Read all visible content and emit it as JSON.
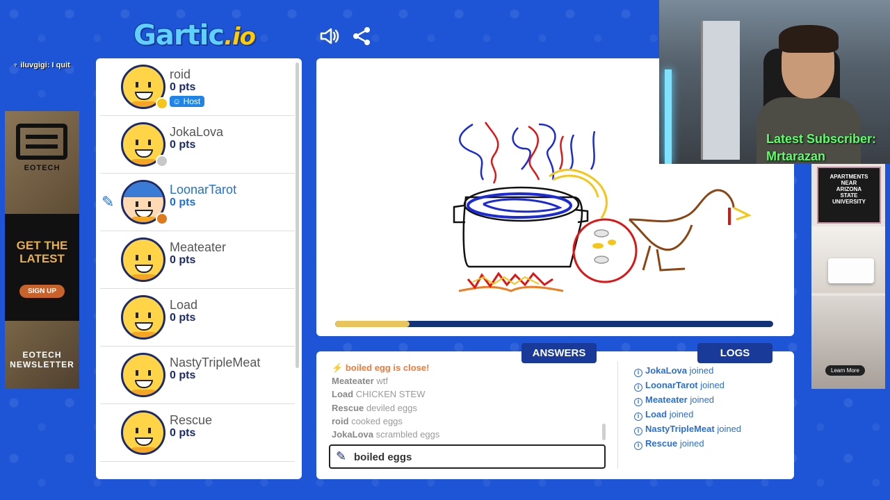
{
  "app": {
    "logo_main": "Gartic",
    "logo_suffix": ".io"
  },
  "toolbar": {
    "sound_icon": "speaker-icon",
    "share_icon": "share-icon"
  },
  "stream_chat": {
    "message": "iluvgigi: I quit"
  },
  "ad_left": {
    "brand": "EOTECH",
    "headline_line1": "GET THE",
    "headline_line2": "LATEST",
    "cta": "SIGN UP",
    "footer_line1": "EOTECH",
    "footer_line2": "NEWSLETTER"
  },
  "players": [
    {
      "name": "roid",
      "points": "0 pts",
      "host_label": "Host",
      "status_color": "#f5c518"
    },
    {
      "name": "JokaLova",
      "points": "0 pts",
      "status_color": "#c8c8c8"
    },
    {
      "name": "LoonarTarot",
      "points": "0 pts",
      "status_color": "#e07a1f",
      "drawing": true
    },
    {
      "name": "Meateater",
      "points": "0 pts"
    },
    {
      "name": "Load",
      "points": "0 pts"
    },
    {
      "name": "NastyTripleMeat",
      "points": "0 pts"
    },
    {
      "name": "Rescue",
      "points": "0 pts"
    }
  ],
  "canvas": {
    "timer_remaining": 0.17
  },
  "tabs": {
    "answers": "ANSWERS",
    "logs": "LOGS"
  },
  "answers": [
    {
      "who": "",
      "text": "boiled egg is close!",
      "close": true
    },
    {
      "who": "Meateater",
      "text": "wtf"
    },
    {
      "who": "Load",
      "text": "CHICKEN STEW"
    },
    {
      "who": "Rescue",
      "text": "deviled eggs"
    },
    {
      "who": "roid",
      "text": "cooked eggs"
    },
    {
      "who": "JokaLova",
      "text": "scrambled eggs"
    }
  ],
  "answer_input": {
    "value": "boiled eggs"
  },
  "logs": [
    {
      "name": "JokaLova",
      "action": "joined"
    },
    {
      "name": "LoonarTarot",
      "action": "joined"
    },
    {
      "name": "Meateater",
      "action": "joined"
    },
    {
      "name": "Load",
      "action": "joined"
    },
    {
      "name": "NastyTripleMeat",
      "action": "joined"
    },
    {
      "name": "Rescue",
      "action": "joined"
    }
  ],
  "webcam": {
    "subscriber_label": "Latest Subscriber:",
    "subscriber_name": "Mrtarazan"
  },
  "ad_right": {
    "title_line1": "APARTMENTS",
    "title_line2": "NEAR",
    "title_line3": "ARIZONA",
    "title_line4": "STATE",
    "title_line5": "UNIVERSITY",
    "cta": "Learn More"
  }
}
